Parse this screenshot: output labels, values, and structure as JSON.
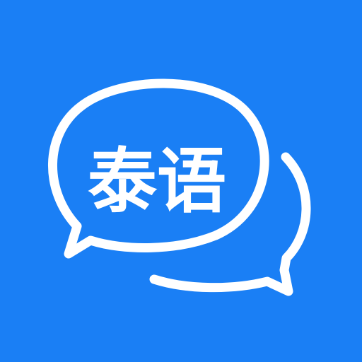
{
  "icon": {
    "label": "泰语",
    "background_color": "#1a7ff5",
    "foreground_color": "#ffffff",
    "glyph": "speech-bubbles-icon"
  }
}
